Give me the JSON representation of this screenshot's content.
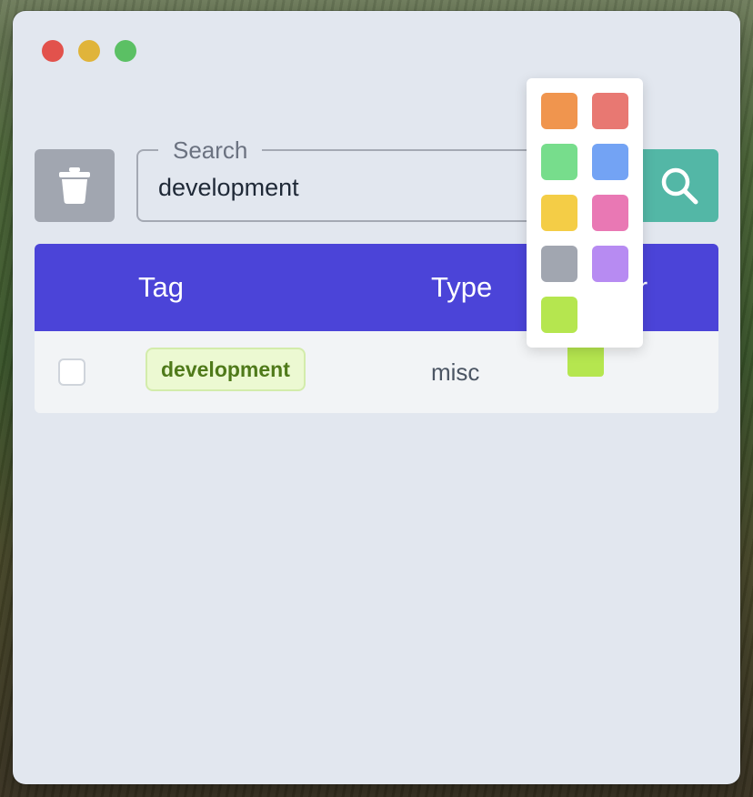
{
  "window": {
    "traffic_lights": [
      "close",
      "minimize",
      "maximize"
    ]
  },
  "toolbar": {
    "trash_icon": "trash-icon",
    "search_legend": "Search",
    "search_value": "development",
    "search_icon": "search-icon"
  },
  "table": {
    "headers": {
      "tag": "Tag",
      "type": "Type",
      "color": "Color"
    },
    "rows": [
      {
        "checked": false,
        "tag": "development",
        "type": "misc",
        "color": "#b5e64f"
      }
    ]
  },
  "palette": {
    "colors": [
      "#f0954e",
      "#e87872",
      "#77dd8c",
      "#73a3f4",
      "#f4cd46",
      "#e978b4",
      "#a1a6b0",
      "#b78bf2",
      "#b5e64f"
    ]
  },
  "colors": {
    "accent": "#4b44d8",
    "search_button": "#53b7a6",
    "trash_button": "#a1a6b0",
    "window_bg": "#e2e7ef"
  }
}
